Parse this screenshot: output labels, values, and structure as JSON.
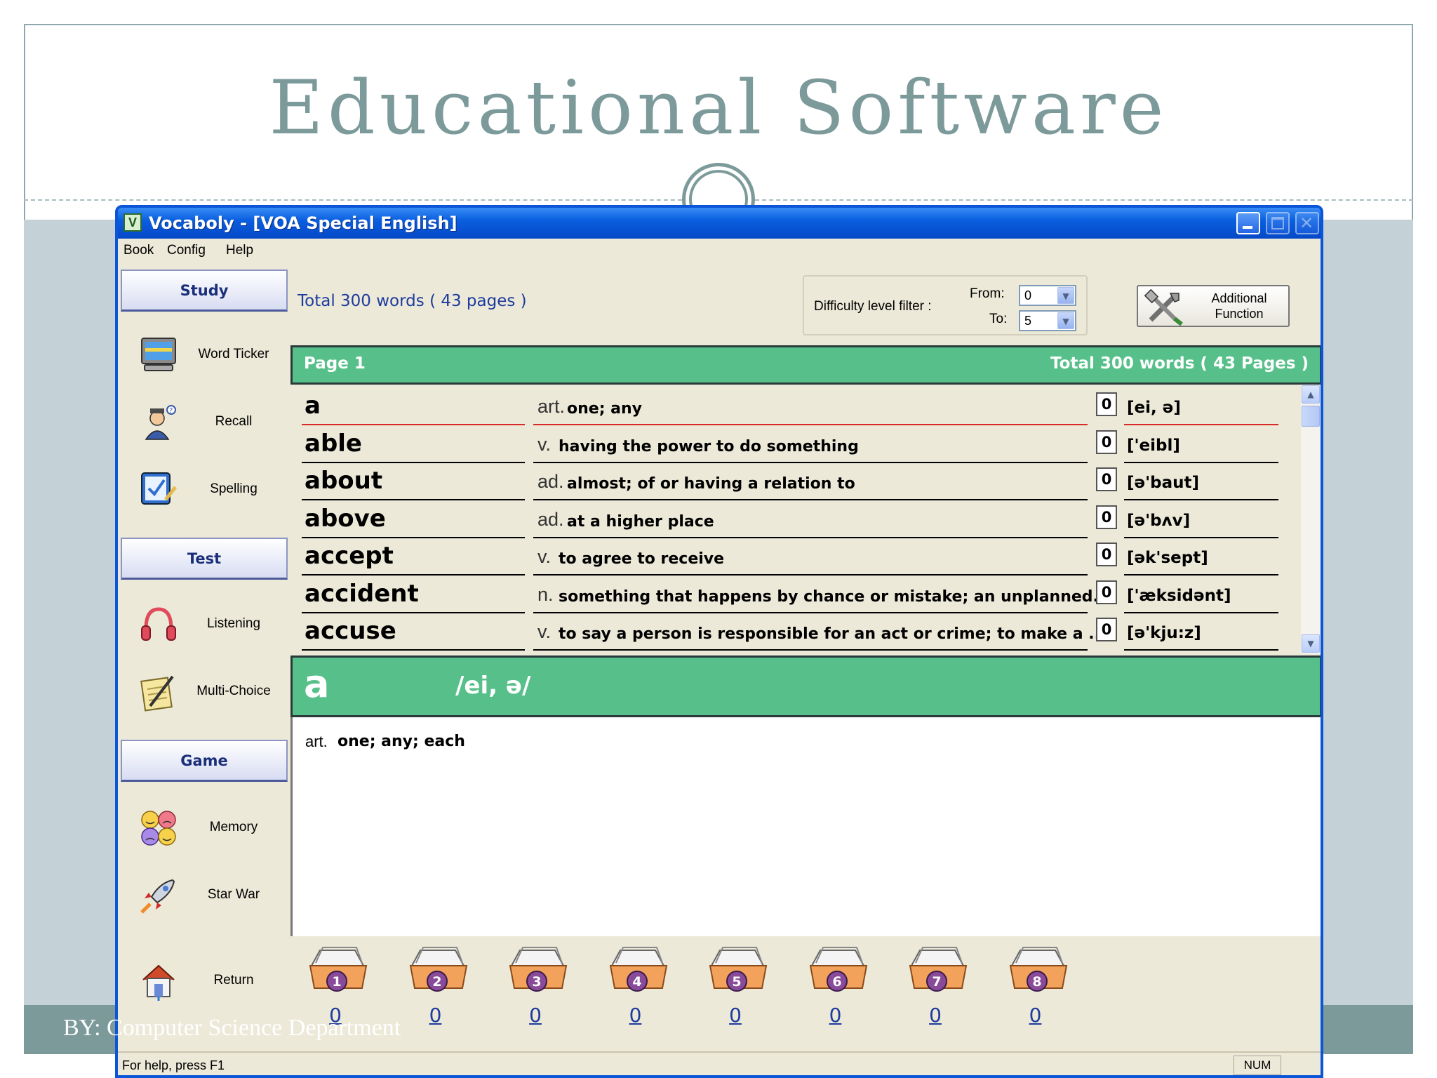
{
  "slide": {
    "title": "Educational Software",
    "footer": "BY: Computer Science Department"
  },
  "window": {
    "title": "Vocaboly - [VOA Special English]",
    "icon_letter": "V",
    "titlebar_buttons": [
      "minimize-icon",
      "maximize-icon",
      "close-icon"
    ]
  },
  "menu": [
    "Book",
    "Config",
    "Help"
  ],
  "sidebar": {
    "study_header": "Study",
    "test_header": "Test",
    "game_header": "Game",
    "study_items": [
      {
        "label": "Word Ticker",
        "icon": "monitor-icon"
      },
      {
        "label": "Recall",
        "icon": "thinking-person-icon"
      },
      {
        "label": "Spelling",
        "icon": "checkmark-pen-icon"
      }
    ],
    "test_items": [
      {
        "label": "Listening",
        "icon": "headphones-icon"
      },
      {
        "label": "Multi-Choice",
        "icon": "notepad-pencil-icon"
      }
    ],
    "game_items": [
      {
        "label": "Memory",
        "icon": "faces-icon"
      },
      {
        "label": "Star War",
        "icon": "rocket-icon"
      }
    ],
    "return_item": {
      "label": "Return",
      "icon": "house-icon"
    }
  },
  "toolbar": {
    "total_words": "Total 300 words ( 43 pages )",
    "difficulty_label": "Difficulty level filter :",
    "from_label": "From:",
    "to_label": "To:",
    "from_value": "0",
    "to_value": "5",
    "additional_label_1": "Additional",
    "additional_label_2": "Function"
  },
  "list": {
    "page_label": "Page 1",
    "total_label": "Total 300 words ( 43 Pages )",
    "rows": [
      {
        "word": "a",
        "pos": "art.",
        "definition": "one; any",
        "count": "0",
        "pronunciation": "[ei, ə]",
        "selected": true
      },
      {
        "word": "able",
        "pos": "v.",
        "definition": "having the power to do something",
        "count": "0",
        "pronunciation": "['eibl]"
      },
      {
        "word": "about",
        "pos": "ad.",
        "definition": "almost; of or having a relation to",
        "count": "0",
        "pronunciation": "[ə'baut]"
      },
      {
        "word": "above",
        "pos": "ad.",
        "definition": "at a higher place",
        "count": "0",
        "pronunciation": "[ə'bʌv]"
      },
      {
        "word": "accept",
        "pos": "v.",
        "definition": "to agree to receive",
        "count": "0",
        "pronunciation": "[ək'sept]"
      },
      {
        "word": "accident",
        "pos": "n.",
        "definition": "something that happens by chance or mistake; an unplanned...",
        "count": "0",
        "pronunciation": "['æksidənt]"
      },
      {
        "word": "accuse",
        "pos": "v.",
        "definition": "to say a person is responsible for an act or crime; to make a ...",
        "count": "0",
        "pronunciation": "[ə'kju:z]"
      }
    ]
  },
  "detail": {
    "word": "a",
    "pronunciation": "/ei, ə/",
    "pos": "art.",
    "definition": "one; any; each"
  },
  "boxes": [
    {
      "number": "1",
      "count": "0"
    },
    {
      "number": "2",
      "count": "0"
    },
    {
      "number": "3",
      "count": "0"
    },
    {
      "number": "4",
      "count": "0"
    },
    {
      "number": "5",
      "count": "0"
    },
    {
      "number": "6",
      "count": "0"
    },
    {
      "number": "7",
      "count": "0"
    },
    {
      "number": "8",
      "count": "0"
    }
  ],
  "status": {
    "help": "For help, press F1",
    "num": "NUM"
  },
  "colors": {
    "accent_green": "#57c08a",
    "title_blue": "#0a5fe0",
    "link_blue": "#1e3b9e",
    "slide_teal": "#7d9a9b"
  }
}
